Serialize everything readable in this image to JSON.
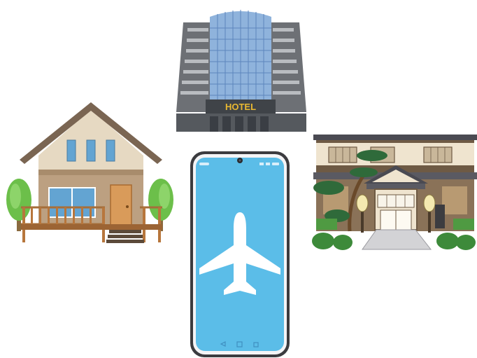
{
  "hotel": {
    "sign": "HOTEL"
  },
  "phone": {
    "icon": "airplane-icon"
  },
  "colors": {
    "phone_screen": "#5bbde8",
    "hotel_glass": "#8fb3dc",
    "house_wall": "#e6d9c2",
    "house_roof": "#7a6552",
    "tree_green": "#6cbf4a",
    "ryokan_wood": "#6e5a44"
  }
}
